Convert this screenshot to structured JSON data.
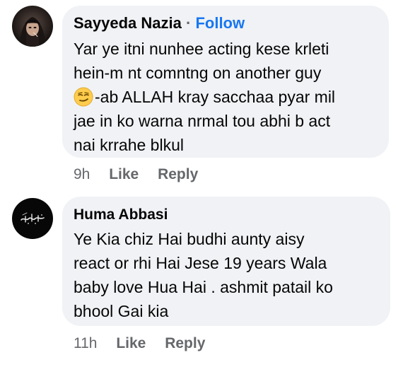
{
  "comments": [
    {
      "author": "Sayyeda Nazia",
      "separator": "·",
      "follow_label": "Follow",
      "lines": [
        "Yar ye itni nunhee acting kese krleti",
        "hein-m nt comntng on another guy",
        "-ab ALLAH kray sacchaa pyar mil",
        "jae in ko warna nrmal tou abhi b act",
        "nai krrahe blkul"
      ],
      "emoji": "smirking-face-emoji",
      "time": "9h",
      "like_label": "Like",
      "reply_label": "Reply"
    },
    {
      "author": "Huma Abbasi",
      "lines": [
        "Ye Kia chiz Hai budhi aunty aisy",
        "react or rhi Hai Jese 19 years Wala",
        "baby love Hua Hai . ashmit patail ko",
        "bhool Gai kia"
      ],
      "time": "11h",
      "like_label": "Like",
      "reply_label": "Reply"
    }
  ],
  "colors": {
    "bubble": "#f0f2f5",
    "follow": "#1877f2",
    "meta": "#65676b",
    "text": "#050505"
  }
}
